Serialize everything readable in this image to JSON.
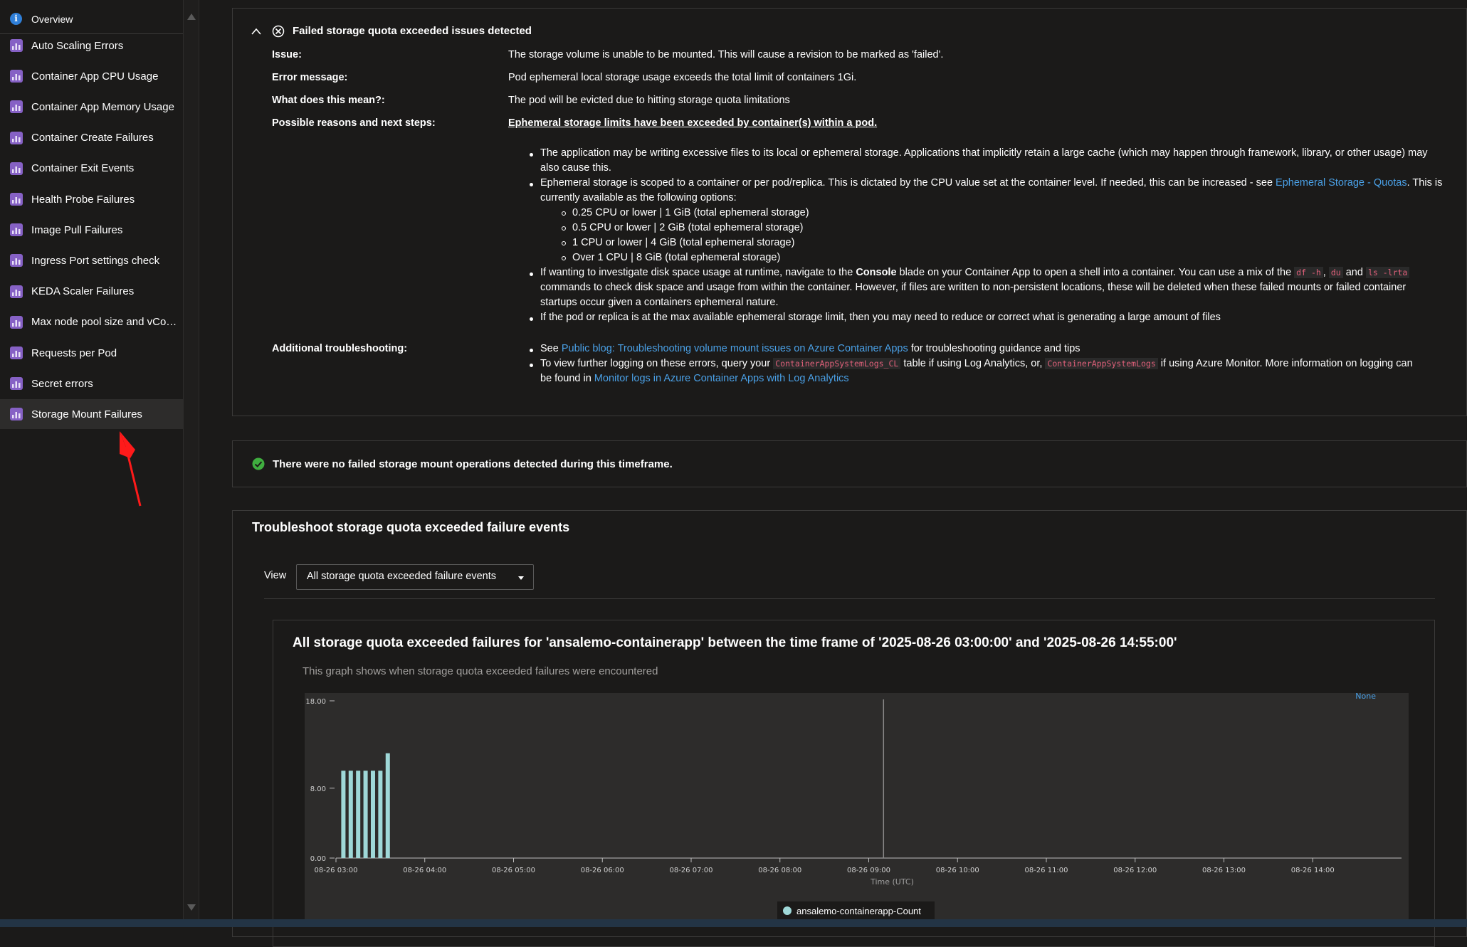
{
  "sidebar": {
    "overview_label": "Overview",
    "items": [
      {
        "label": "Auto Scaling Errors",
        "name": "sidebar-item-auto-scaling-errors"
      },
      {
        "label": "Container App CPU Usage",
        "name": "sidebar-item-container-app-cpu-usage"
      },
      {
        "label": "Container App Memory Usage",
        "name": "sidebar-item-container-app-memory-usage"
      },
      {
        "label": "Container Create Failures",
        "name": "sidebar-item-container-create-failures"
      },
      {
        "label": "Container Exit Events",
        "name": "sidebar-item-container-exit-events"
      },
      {
        "label": "Health Probe Failures",
        "name": "sidebar-item-health-probe-failures"
      },
      {
        "label": "Image Pull Failures",
        "name": "sidebar-item-image-pull-failures"
      },
      {
        "label": "Ingress Port settings check",
        "name": "sidebar-item-ingress-port-settings-check"
      },
      {
        "label": "KEDA Scaler Failures",
        "name": "sidebar-item-keda-scaler-failures"
      },
      {
        "label": "Max node pool size and vCor...",
        "name": "sidebar-item-max-node-pool-size"
      },
      {
        "label": "Requests per Pod",
        "name": "sidebar-item-requests-per-pod"
      },
      {
        "label": "Secret errors",
        "name": "sidebar-item-secret-errors"
      },
      {
        "label": "Storage Mount Failures",
        "name": "sidebar-item-storage-mount-failures"
      }
    ],
    "active_item": "Storage Mount Failures",
    "icon_color": "#8661c5"
  },
  "issue_panel": {
    "title": "Failed storage quota exceeded issues detected",
    "issue_key": "Issue:",
    "issue_value": "The storage volume is unable to be mounted. This will cause a revision to be marked as 'failed'.",
    "error_key": "Error message:",
    "error_value": "Pod ephemeral local storage usage exceeds the total limit of containers 1Gi.",
    "meaning_key": "What does this mean?:",
    "meaning_value": "The pod will be evicted due to hitting storage quota limitations",
    "reasons_key": "Possible reasons and next steps:",
    "reasons_heading": "Ephemeral storage limits have been exceeded by container(s) within a pod.",
    "b1_l1": "The application may be writing excessive files to its local or ephemeral storage. Applications that implicitly retain a large cache (which may happen through framework, library, or other usage) may",
    "b1_l2": "also cause this.",
    "b2_l1a": "Ephemeral storage is scoped to a container or per pod/replica. This is dictated by the CPU value set at the container level. If needed, this can be increased - see ",
    "b2_link": "Ephemeral Storage - Quotas",
    "b2_l1b": ". This is",
    "b2_l2": "currently available as the following options:",
    "sub_options": [
      "0.25 CPU or lower | 1 GiB (total ephemeral storage)",
      "0.5 CPU or lower | 2 GiB (total ephemeral storage)",
      "1 CPU or lower | 4 GiB (total ephemeral storage)",
      "Over 1 CPU | 8 GiB (total ephemeral storage)"
    ],
    "b3_l1a": "If wanting to investigate disk space usage at runtime, navigate to the ",
    "b3_bold": "Console",
    "b3_l1b": " blade on your Container App to open a shell into a container. You can use a mix of the ",
    "b3_code1": "df -h",
    "b3_comma": ", ",
    "b3_code2": "du",
    "b3_and": " and ",
    "b3_code3": "ls -lrta",
    "b3_l2": "commands to check disk space and usage from within the container. However, if files are written to non-persistent locations, these will be deleted when these failed mounts or failed container",
    "b3_l3": "startups occur given a containers ephemeral nature.",
    "b4": "If the pod or replica is at the max available ephemeral storage limit, then you may need to reduce or correct what is generating a large amount of files",
    "additional_key": "Additional troubleshooting:",
    "a1_pre": "See ",
    "a1_link": "Public blog: Troubleshooting volume mount issues on Azure Container Apps",
    "a1_post": " for troubleshooting guidance and tips",
    "a2_pre": "To view further logging on these errors, query your ",
    "a2_code1": "ContainerAppSystemLogs_CL",
    "a2_mid": " table if using Log Analytics, or, ",
    "a2_code2": "ContainerAppSystemLogs",
    "a2_post": " if using Azure Monitor. More information on logging can",
    "a2_l2_pre": "be found in ",
    "a2_link": "Monitor logs in Azure Container Apps with Log Analytics"
  },
  "success_panel": {
    "message": "There were no failed storage mount operations detected during this timeframe."
  },
  "events_panel": {
    "title": "Troubleshoot storage quota exceeded failure events",
    "view_label": "View",
    "view_selected": "All storage quota exceeded failure events",
    "chart_title": "All storage quota exceeded failures for 'ansalemo-containerapp' between the time frame of '2025-08-26 03:00:00' and '2025-08-26 14:55:00'",
    "chart_subtitle": "This graph shows when storage quota exceeded failures were encountered"
  },
  "chart_data": {
    "type": "bar",
    "xlabel": "Time (UTC)",
    "ylabel": "",
    "ylim": [
      0,
      18
    ],
    "y_ticks": [
      "0.00",
      "8.00",
      "18.00"
    ],
    "x_ticks": [
      "08-26 03:00",
      "08-26 04:00",
      "08-26 05:00",
      "08-26 06:00",
      "08-26 07:00",
      "08-26 08:00",
      "08-26 09:00",
      "08-26 10:00",
      "08-26 11:00",
      "08-26 12:00",
      "08-26 13:00",
      "08-26 14:00"
    ],
    "x_range": [
      "08-26 03:00",
      "08-26 15:00"
    ],
    "series": [
      {
        "name": "ansalemo-containerapp-Count",
        "color": "#9fd8d8",
        "points": [
          {
            "x": "08-26 03:05",
            "y": 10
          },
          {
            "x": "08-26 03:10",
            "y": 10
          },
          {
            "x": "08-26 03:15",
            "y": 10
          },
          {
            "x": "08-26 03:20",
            "y": 10
          },
          {
            "x": "08-26 03:25",
            "y": 10
          },
          {
            "x": "08-26 03:30",
            "y": 10
          },
          {
            "x": "08-26 03:35",
            "y": 12
          }
        ]
      }
    ],
    "legend_position": "bottom",
    "annotation_label": "None",
    "annotation_x": "08-26 09:10"
  }
}
